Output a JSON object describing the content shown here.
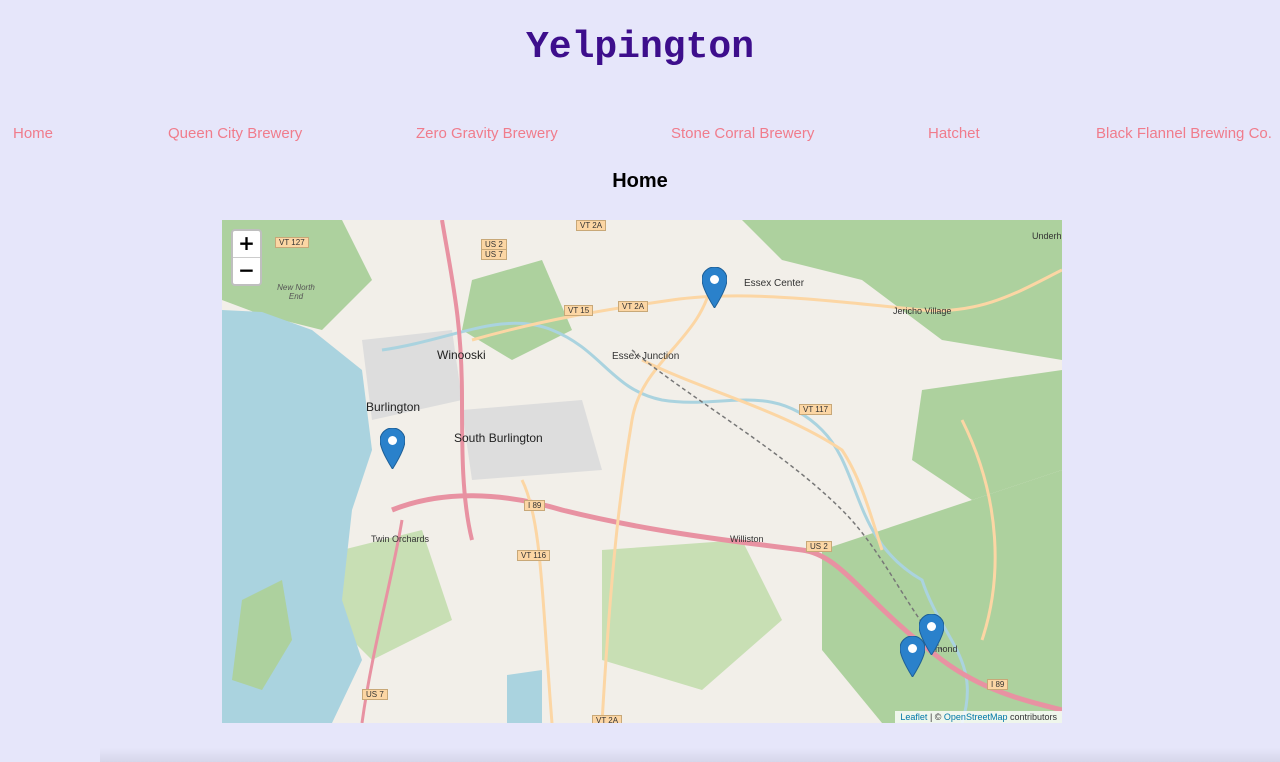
{
  "site": {
    "title": "Yelpington"
  },
  "nav": {
    "items": [
      {
        "label": "Home"
      },
      {
        "label": "Queen City Brewery"
      },
      {
        "label": "Zero Gravity Brewery"
      },
      {
        "label": "Stone Corral Brewery"
      },
      {
        "label": "Hatchet"
      },
      {
        "label": "Black Flannel Brewing Co."
      }
    ]
  },
  "page": {
    "heading": "Home"
  },
  "map": {
    "zoom_in_label": "+",
    "zoom_out_label": "−",
    "attribution": {
      "leaflet": "Leaflet",
      "sep": " | © ",
      "osm": "OpenStreetMap",
      "suffix": " contributors"
    },
    "place_labels": [
      "Burlington",
      "South Burlington",
      "Winooski",
      "Essex Junction",
      "Essex Center",
      "Jericho Village",
      "Twin Orchards",
      "Williston",
      "New North End",
      "Underh",
      "hmond"
    ],
    "road_labels": [
      "VT 127",
      "US 2",
      "US 7",
      "VT 15",
      "VT 2A",
      "VT 117",
      "I 89",
      "VT 116",
      "US 2",
      "US 7",
      "VT 2A",
      "I 89",
      "VT 2A"
    ],
    "colors": {
      "water": "#aad3df",
      "park": "#add19e",
      "land": "#f2efe9",
      "highway": "#e892a2",
      "primary": "#fcd6a4",
      "marker": "#2a81cb"
    }
  }
}
